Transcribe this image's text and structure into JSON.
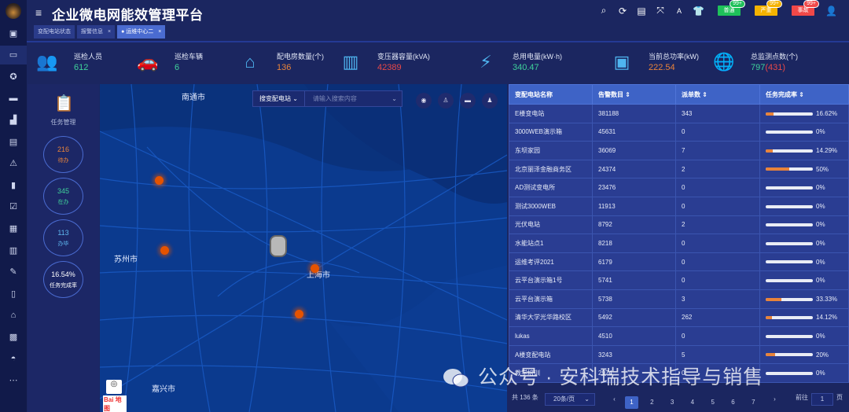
{
  "header": {
    "title": "企业微电网能效管理平台",
    "tabs": [
      {
        "label": "变配电站状态",
        "active": false
      },
      {
        "label": "报警信息",
        "active": false
      },
      {
        "label": "运维中心二",
        "active": true
      }
    ],
    "tab_close": "×",
    "alerts": [
      {
        "label": "普通",
        "badge": "99+",
        "color": "#1fc15a"
      },
      {
        "label": "严重",
        "badge": "99+",
        "color": "#f5b300"
      },
      {
        "label": "事故",
        "badge": "99+",
        "color": "#f04848"
      }
    ]
  },
  "stats": [
    {
      "label": "巡检人员",
      "value": "612",
      "color": "#3fd19a",
      "icon": "inspector-icon"
    },
    {
      "label": "巡检车辆",
      "value": "6",
      "color": "#3fd19a",
      "icon": "car-icon"
    },
    {
      "label": "配电房数量(个)",
      "value": "136",
      "color": "#e8833a",
      "icon": "house-icon"
    },
    {
      "label": "变压器容量(kVA)",
      "value": "42389",
      "color": "#e84848",
      "icon": "transformer-icon"
    },
    {
      "label": "总用电量(kW·h)",
      "value": "340.47",
      "color": "#3fd19a",
      "icon": "energy-icon"
    },
    {
      "label": "当前总功率(kW)",
      "value": "222.54",
      "color": "#e8833a",
      "icon": "monitor-icon"
    },
    {
      "label": "总监测点数(个)",
      "value": "797",
      "value_extra": "(431)",
      "color": "#3fd19a",
      "extra_color": "#e84848",
      "icon": "globe-pin-icon"
    }
  ],
  "task": {
    "title": "任务管理",
    "items": [
      {
        "value": "216",
        "label": "待办",
        "color": "#e8833a"
      },
      {
        "value": "345",
        "label": "在办",
        "color": "#3fd19a"
      },
      {
        "value": "113",
        "label": "办毕",
        "color": "#5fb8f0"
      },
      {
        "value": "16.54%",
        "label": "任务完成率",
        "color": "#ffffff"
      }
    ]
  },
  "map": {
    "search_type": "搜变配电站",
    "search_placeholder": "请输入搜索内容",
    "cities": [
      "南通市",
      "苏州市",
      "上海市",
      "嘉兴市"
    ]
  },
  "table": {
    "headers": [
      "变配电站名称",
      "告警数目",
      "派单数",
      "任务完成率"
    ],
    "rows": [
      [
        "E楼变电站",
        "381188",
        "343",
        16.62,
        "16.62%"
      ],
      [
        "3000WEB演示箱",
        "45631",
        "0",
        0,
        "0%"
      ],
      [
        "东坝家园",
        "36069",
        "7",
        14.29,
        "14.29%"
      ],
      [
        "北京丽泽金融商务区",
        "24374",
        "2",
        50,
        "50%"
      ],
      [
        "AD测试变电所",
        "23476",
        "0",
        0,
        "0%"
      ],
      [
        "测试3000WEB",
        "11913",
        "0",
        0,
        "0%"
      ],
      [
        "光伏电站",
        "8792",
        "2",
        0,
        "0%"
      ],
      [
        "水能站点1",
        "8218",
        "0",
        0,
        "0%"
      ],
      [
        "运维考评2021",
        "6179",
        "0",
        0,
        "0%"
      ],
      [
        "云平台演示箱1号",
        "5741",
        "0",
        0,
        "0%"
      ],
      [
        "云平台演示箱",
        "5738",
        "3",
        33.33,
        "33.33%"
      ],
      [
        "清华大学光华路校区",
        "5492",
        "262",
        14.12,
        "14.12%"
      ],
      [
        "lukas",
        "4510",
        "0",
        0,
        "0%"
      ],
      [
        "A楼变配电站",
        "3243",
        "5",
        20,
        "20%"
      ],
      [
        "教学培训",
        "2974",
        "0",
        0,
        "0%"
      ]
    ]
  },
  "pager": {
    "total": "共 136 条",
    "size": "20条/页",
    "pages": [
      "1",
      "2",
      "3",
      "4",
      "5",
      "6",
      "7"
    ],
    "current": "1",
    "goto_label": "前往",
    "goto_value": "1",
    "page_suffix": "页"
  },
  "watermark": "公众号 · 安科瑞技术指导与销售"
}
